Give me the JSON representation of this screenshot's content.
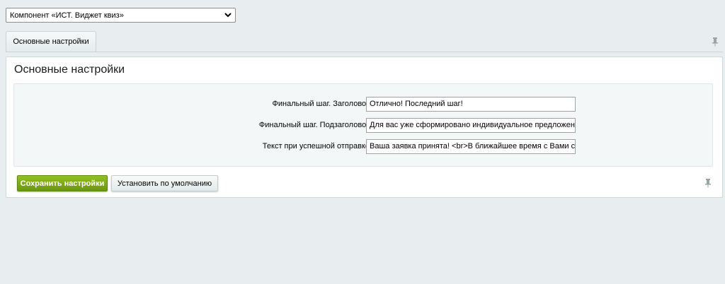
{
  "component_select": {
    "value": "Компонент «ИСТ. Виджет квиз»",
    "icon": "chevron-down-icon"
  },
  "tabs": [
    {
      "label": "Основные настройки",
      "active": true
    }
  ],
  "pin_icon": "pin-icon",
  "panel": {
    "title": "Основные настройки",
    "fields": [
      {
        "label": "Финальный шаг. Заголовок",
        "value": "Отлично! Последний шаг!"
      },
      {
        "label": "Финальный шаг. Подзаголовок",
        "value": "Для вас уже сформировано индивидуальное предложение! <b"
      },
      {
        "label": "Текст при успешной отправке",
        "value": "Ваша заявка принята! <br>В ближайшее время с Вами свяжет"
      }
    ],
    "save_label": "Сохранить настройки",
    "default_label": "Установить по умолчанию"
  },
  "colors": {
    "background": "#e8edef",
    "save_button": "#7fab18"
  }
}
